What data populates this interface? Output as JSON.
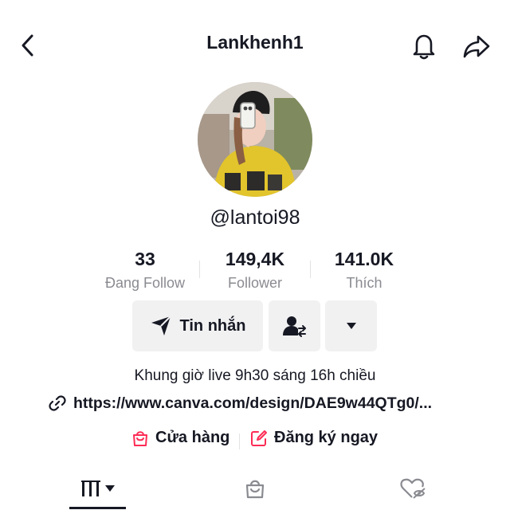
{
  "header": {
    "title": "Lankhenh1",
    "icons": [
      "back-arrow-icon",
      "bell-icon",
      "share-icon"
    ]
  },
  "profile": {
    "username": "@lantoi98"
  },
  "stats": [
    {
      "value": "33",
      "label": "Đang Follow"
    },
    {
      "value": "149,4K",
      "label": "Follower"
    },
    {
      "value": "141.0K",
      "label": "Thích"
    }
  ],
  "actions": {
    "message_label": "Tin nhắn",
    "icons": [
      "send-icon",
      "add-friend-icon",
      "caret-down-icon"
    ]
  },
  "bio": "Khung giờ live 9h30 sáng 16h chiều",
  "link": {
    "text": "https://www.canva.com/design/DAE9w44QTg0/...",
    "icon": "link-icon"
  },
  "shop_links": {
    "shop_label": "Cửa hàng",
    "signup_label": "Đăng ký ngay",
    "accent": "#fe2c55"
  },
  "tabs": [
    "grid-icon",
    "shop-bag-icon",
    "liked-hidden-icon"
  ]
}
